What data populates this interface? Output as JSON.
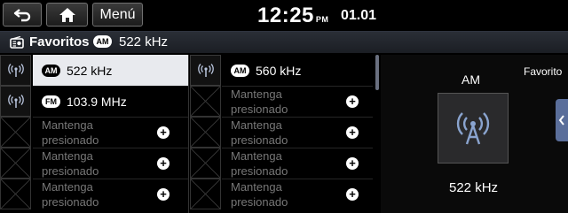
{
  "header": {
    "menu_label": "Menú",
    "time": "12:25",
    "ampm": "PM",
    "date": "01.01"
  },
  "titlebar": {
    "title": "Favoritos",
    "band": "AM",
    "frequency": "522 kHz"
  },
  "presets_left": [
    {
      "band": "AM",
      "frequency": "522 kHz",
      "selected": true
    },
    {
      "band": "FM",
      "frequency": "103.9 MHz",
      "selected": false
    },
    {
      "empty_line1": "Mantenga",
      "empty_line2": "presionado"
    },
    {
      "empty_line1": "Mantenga",
      "empty_line2": "presionado"
    },
    {
      "empty_line1": "Mantenga",
      "empty_line2": "presionado"
    }
  ],
  "presets_right": [
    {
      "band": "AM",
      "frequency": "560 kHz"
    },
    {
      "empty_line1": "Mantenga",
      "empty_line2": "presionado"
    },
    {
      "empty_line1": "Mantenga",
      "empty_line2": "presionado"
    },
    {
      "empty_line1": "Mantenga",
      "empty_line2": "presionado"
    },
    {
      "empty_line1": "Mantenga",
      "empty_line2": "presionado"
    }
  ],
  "now_playing": {
    "favorite_label": "Favorito",
    "band": "AM",
    "frequency": "522 kHz"
  },
  "icons": [
    "back-icon",
    "home-icon",
    "radio-icon",
    "antenna-icon",
    "add-icon",
    "chevron-left-icon"
  ],
  "colors": {
    "selected_row": "#e8eaee",
    "side_tab": "#5a6e9a",
    "placeholder_text": "#777777"
  }
}
